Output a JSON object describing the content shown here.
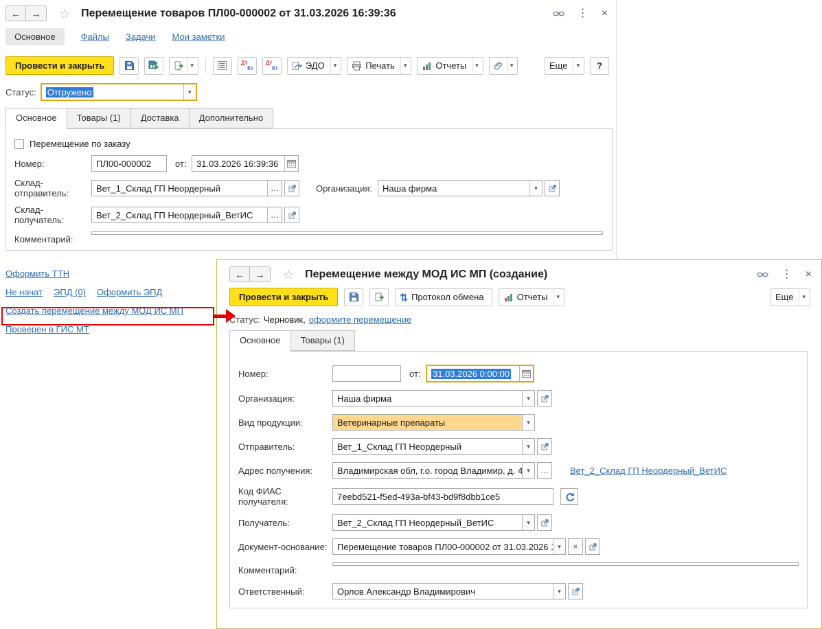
{
  "colors": {
    "primary_yellow": "#ffe01a",
    "primary_yellow_border": "#c9ac00",
    "link_blue": "#2e6eb5",
    "selection_blue": "#2f7ddb",
    "required_field_bg": "#ffd88f",
    "focus_border": "#dca915",
    "annotation_red": "#e60000",
    "subwindow_border": "#c8ba52",
    "field_border": "#a8a8a8",
    "panel_border": "#c9c9c9"
  },
  "icons": {
    "back": "←",
    "forward": "→",
    "star": "☆",
    "kebab": "⋮",
    "close": "×",
    "dropdown": "▾",
    "ellipsis": "…",
    "help": "?",
    "exchange": "⇅",
    "dt": "Дт",
    "kt": "Кт",
    "clear": "×"
  },
  "main_window": {
    "title": "Перемещение товаров ПЛ00-000002 от 31.03.2026 16:39:36",
    "nav_tabs": [
      {
        "label": "Основное",
        "active": true
      },
      {
        "label": "Файлы"
      },
      {
        "label": "Задачи"
      },
      {
        "label": "Мои заметки"
      }
    ],
    "toolbar": {
      "post_and_close": "Провести и закрыть",
      "edo": "ЭДО",
      "print": "Печать",
      "reports": "Отчеты",
      "more": "Еще"
    },
    "status": {
      "label": "Статус:",
      "value": "Отгружено"
    },
    "doc_tabs": [
      {
        "label": "Основное",
        "active": true
      },
      {
        "label": "Товары (1)"
      },
      {
        "label": "Доставка"
      },
      {
        "label": "Дополнительно"
      }
    ],
    "form": {
      "order_checkbox_label": "Перемещение по заказу",
      "number_label": "Номер:",
      "number": "ПЛ00-000002",
      "date_label": "от:",
      "date": "31.03.2026 16:39:36",
      "warehouse_from_label": "Склад-отправитель:",
      "warehouse_from": "Вет_1_Склад ГП Неордерный",
      "organization_label": "Организация:",
      "organization": "Наша фирма",
      "warehouse_to_label": "Склад-получатель:",
      "warehouse_to": "Вет_2_Склад ГП Неордерный_ВетИС",
      "comment_label": "Комментарий:",
      "comment": ""
    },
    "links": {
      "ttn": "Оформить ТТН",
      "epd_status": "Не начат",
      "epd": "ЭПД (0)",
      "make_epd": "Оформить ЭПД",
      "create_transfer": "Создать перемещение между МОД ИС МП",
      "gis_mt": "Проверен в ГИС МТ"
    }
  },
  "sub_window": {
    "title": "Перемещение между МОД ИС МП (создание)",
    "toolbar": {
      "post_and_close": "Провести и закрыть",
      "protocol": "Протокол обмена",
      "reports": "Отчеты",
      "more": "Еще"
    },
    "status": {
      "label": "Статус:",
      "value": "Черновик,",
      "link": "оформите перемещение"
    },
    "doc_tabs": [
      {
        "label": "Основное",
        "active": true
      },
      {
        "label": "Товары (1)"
      }
    ],
    "form": {
      "number_label": "Номер:",
      "number": "",
      "date_label": "от:",
      "date": "31.03.2026 0:00:00",
      "organization_label": "Организация:",
      "organization": "Наша фирма",
      "product_type_label": "Вид продукции:",
      "product_type": "Ветеринарные препараты",
      "sender_label": "Отправитель:",
      "sender": "Вет_1_Склад ГП Неордерный",
      "address_label": "Адрес получения:",
      "address": "Владимирская обл, г.о. город Владимир, д. 4",
      "address_link": "Вет_2_Склад ГП Неордерный_ВетИС",
      "fias_label": "Код ФИАС получателя:",
      "fias": "7eebd521-f5ed-493a-bf43-bd9f8dbb1ce5",
      "receiver_label": "Получатель:",
      "receiver": "Вет_2_Склад ГП Неордерный_ВетИС",
      "basis_label": "Документ-основание:",
      "basis": "Перемещение товаров ПЛ00-000002 от 31.03.2026 1",
      "comment_label": "Комментарий:",
      "comment": "",
      "responsible_label": "Ответственный:",
      "responsible": "Орлов Александр Владимирович"
    }
  }
}
